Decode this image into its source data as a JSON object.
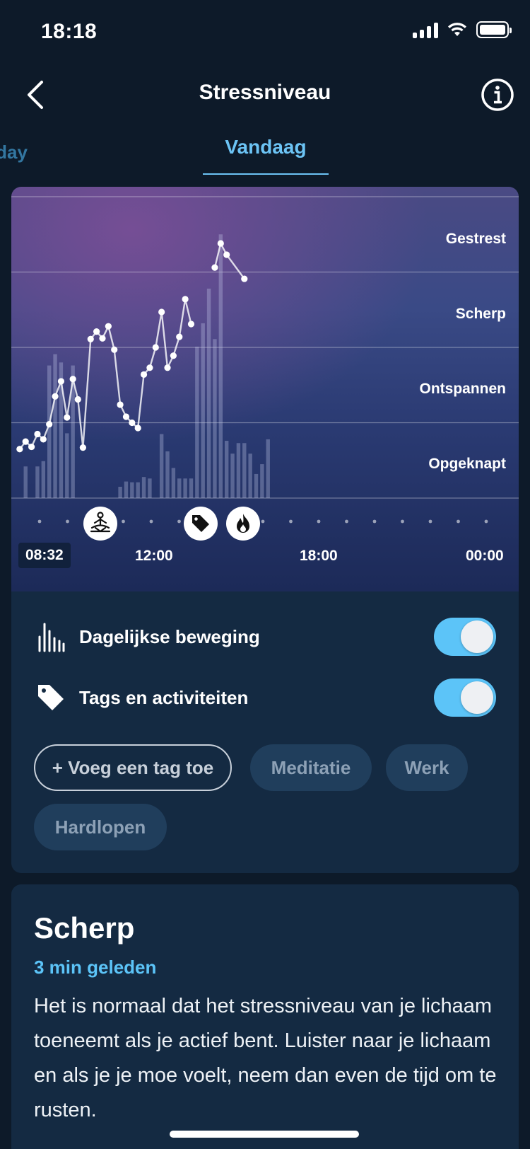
{
  "status_bar": {
    "time": "18:18"
  },
  "nav": {
    "title": "Stressniveau"
  },
  "tabs": {
    "previous": "rday",
    "active": "Vandaag"
  },
  "chart_data": {
    "type": "line",
    "y_levels": [
      "Gestrest",
      "Scherp",
      "Ontspannen",
      "Opgeknapt"
    ],
    "x_tick_labels": [
      "08:32",
      "12:00",
      "18:00",
      "00:00"
    ],
    "stress_line": {
      "segments": [
        [
          [
            8.53,
            0.65
          ],
          [
            8.73,
            0.75
          ],
          [
            8.93,
            0.68
          ],
          [
            9.13,
            0.85
          ],
          [
            9.33,
            0.78
          ],
          [
            9.53,
            0.98
          ],
          [
            9.73,
            1.35
          ],
          [
            9.93,
            1.55
          ],
          [
            10.13,
            1.07
          ],
          [
            10.33,
            1.58
          ],
          [
            10.5,
            1.31
          ],
          [
            10.67,
            0.67
          ],
          [
            10.93,
            2.11
          ],
          [
            11.13,
            2.21
          ],
          [
            11.33,
            2.12
          ],
          [
            11.53,
            2.28
          ],
          [
            11.73,
            1.97
          ],
          [
            11.93,
            1.24
          ],
          [
            12.13,
            1.08
          ],
          [
            12.33,
            1.0
          ],
          [
            12.53,
            0.93
          ],
          [
            12.73,
            1.64
          ],
          [
            12.93,
            1.73
          ],
          [
            13.13,
            2.0
          ],
          [
            13.33,
            2.47
          ],
          [
            13.53,
            1.73
          ],
          [
            13.73,
            1.89
          ],
          [
            13.93,
            2.14
          ],
          [
            14.13,
            2.64
          ],
          [
            14.33,
            2.31
          ]
        ],
        [
          [
            15.13,
            3.06
          ],
          [
            15.33,
            3.38
          ],
          [
            15.53,
            3.23
          ],
          [
            16.13,
            2.91
          ]
        ]
      ]
    },
    "movement_bars": [
      {
        "x": 8.73,
        "v": 0.42
      },
      {
        "x": 9.13,
        "v": 0.42
      },
      {
        "x": 9.33,
        "v": 0.49
      },
      {
        "x": 9.53,
        "v": 1.76
      },
      {
        "x": 9.73,
        "v": 1.91
      },
      {
        "x": 9.93,
        "v": 1.8
      },
      {
        "x": 10.13,
        "v": 0.86
      },
      {
        "x": 10.33,
        "v": 1.76
      },
      {
        "x": 11.93,
        "v": 0.15
      },
      {
        "x": 12.13,
        "v": 0.22
      },
      {
        "x": 12.33,
        "v": 0.21
      },
      {
        "x": 12.53,
        "v": 0.21
      },
      {
        "x": 12.73,
        "v": 0.28
      },
      {
        "x": 12.93,
        "v": 0.26
      },
      {
        "x": 13.33,
        "v": 0.85
      },
      {
        "x": 13.53,
        "v": 0.62
      },
      {
        "x": 13.73,
        "v": 0.4
      },
      {
        "x": 13.93,
        "v": 0.26
      },
      {
        "x": 14.13,
        "v": 0.26
      },
      {
        "x": 14.33,
        "v": 0.26
      },
      {
        "x": 14.53,
        "v": 2.01
      },
      {
        "x": 14.73,
        "v": 2.32
      },
      {
        "x": 14.93,
        "v": 2.78
      },
      {
        "x": 15.13,
        "v": 2.11
      },
      {
        "x": 15.33,
        "v": 3.5
      },
      {
        "x": 15.53,
        "v": 0.76
      },
      {
        "x": 15.73,
        "v": 0.59
      },
      {
        "x": 15.93,
        "v": 0.73
      },
      {
        "x": 16.13,
        "v": 0.73
      },
      {
        "x": 16.33,
        "v": 0.59
      },
      {
        "x": 16.53,
        "v": 0.32
      },
      {
        "x": 16.73,
        "v": 0.45
      },
      {
        "x": 16.93,
        "v": 0.78
      }
    ],
    "xlim": [
      "08:32",
      "00:00"
    ],
    "ylim": [
      0,
      4
    ]
  },
  "chart_events": [
    {
      "icon": "meditation-icon"
    },
    {
      "icon": "tag-icon"
    },
    {
      "icon": "flame-icon"
    }
  ],
  "toggles": [
    {
      "label": "Dagelijkse beweging",
      "icon": "activity-bars-icon",
      "on": true
    },
    {
      "label": "Tags en activiteiten",
      "icon": "tag-icon",
      "on": true
    }
  ],
  "chips": {
    "add": "+ Voeg een tag toe",
    "tags": [
      "Meditatie",
      "Werk",
      "Hardlopen"
    ]
  },
  "info": {
    "title": "Scherp",
    "time": "3 min geleden",
    "text": "Het is normaal dat het stressniveau van je lichaam toeneemt als je actief bent. Luister naar je lichaam en als je je moe voelt, neem dan even de tijd om te rusten."
  },
  "colors": {
    "background": "#0d1a29",
    "card": "#142a42",
    "accent": "#5cc4f8",
    "tab_active": "#6cc4f5",
    "chip_bg": "#203e5c"
  }
}
